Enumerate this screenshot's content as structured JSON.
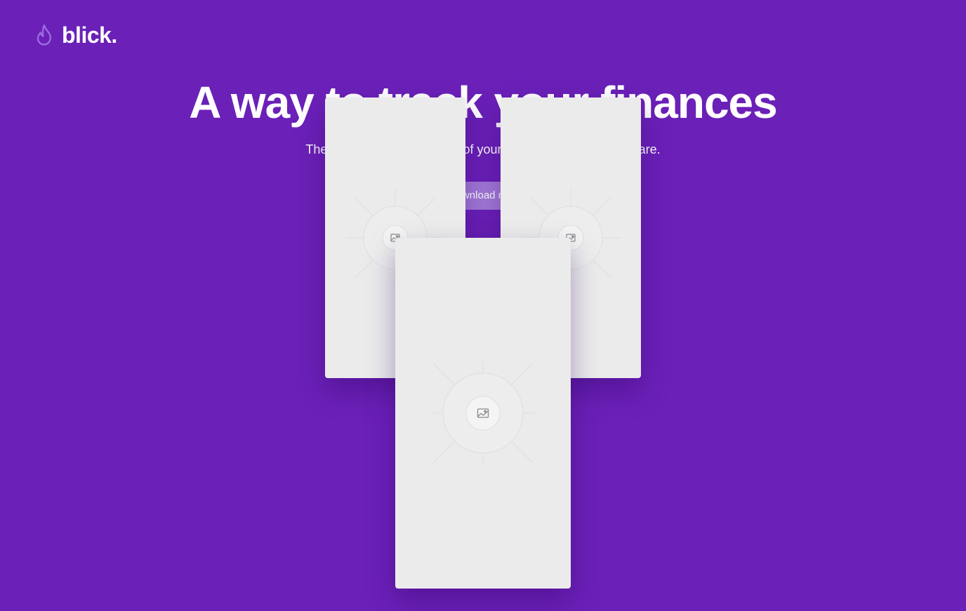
{
  "brand": {
    "name": "blick.",
    "icon": "flame-icon",
    "icon_color": "#9a6be0"
  },
  "hero": {
    "title": "A way to track your finances",
    "subtitle": "The easy way to keep track of your finances, wherever you are.",
    "cta_label": "Download now"
  },
  "mockups": [
    {
      "name": "phone-mockup-left",
      "placeholder_icon": "image-placeholder-icon"
    },
    {
      "name": "phone-mockup-right",
      "placeholder_icon": "image-placeholder-icon"
    },
    {
      "name": "phone-mockup-center",
      "placeholder_icon": "image-placeholder-icon"
    }
  ],
  "colors": {
    "background": "#6b20b8",
    "button": "#a37ad8",
    "mockup": "#ebebeb"
  }
}
